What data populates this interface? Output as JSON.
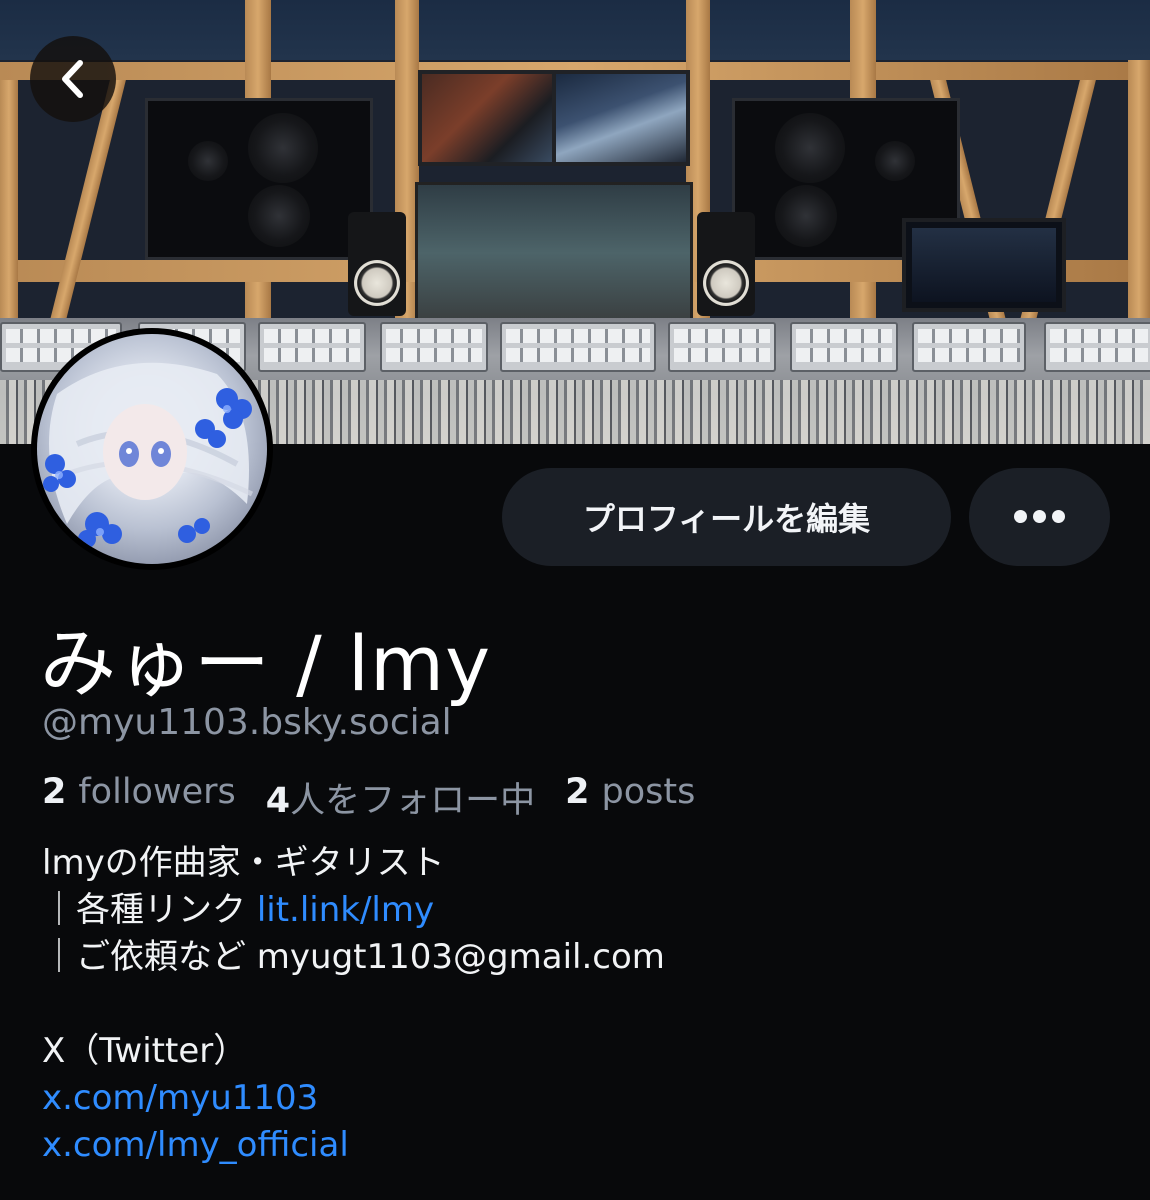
{
  "header": {
    "back_icon": "chevron-left-icon",
    "banner_alt": "recording-studio-banner"
  },
  "actions": {
    "edit_profile_label": "プロフィールを編集",
    "more_icon": "ellipsis-icon"
  },
  "profile": {
    "display_name": "みゅー / lmy",
    "handle": "@myu1103.bsky.social",
    "stats": {
      "followers_count": "2",
      "followers_label": "followers",
      "following_count": "4",
      "following_label": "人をフォロー中",
      "posts_count": "2",
      "posts_label": "posts"
    },
    "bio": {
      "line1": "lmyの作曲家・ギタリスト",
      "line2_prefix": "｜各種リンク ",
      "line2_link": "lit.link/lmy",
      "line3": "｜ご依頼など myugt1103@gmail.com",
      "line4": "",
      "line5": "X（Twitter）",
      "link_x1": "x.com/myu1103",
      "link_x2": "x.com/lmy_official"
    }
  },
  "colors": {
    "background": "#08090b",
    "button_bg": "#1b1f26",
    "link": "#2f8cff",
    "muted": "#8c95a3"
  }
}
